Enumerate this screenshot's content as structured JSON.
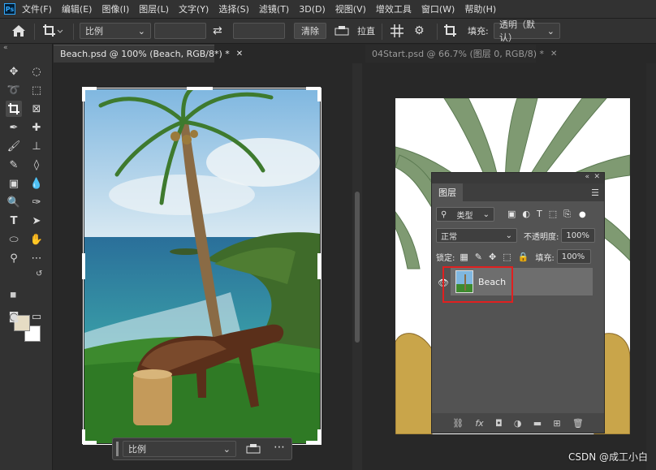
{
  "menubar": {
    "logo": "Ps",
    "items": [
      "文件(F)",
      "编辑(E)",
      "图像(I)",
      "图层(L)",
      "文字(Y)",
      "选择(S)",
      "滤镜(T)",
      "3D(D)",
      "视图(V)",
      "增效工具",
      "窗口(W)",
      "帮助(H)"
    ]
  },
  "options": {
    "ratio_label": "比例",
    "clear_label": "清除",
    "straighten_label": "拉直",
    "fill_label": "填充:",
    "fill_value": "透明（默认）"
  },
  "tabs": {
    "left": "Beach.psd @ 100% (Beach, RGB/8*) *",
    "right": "04Start.psd @ 66.7% (图层 0, RGB/8) *"
  },
  "floatbar": {
    "ratio_label": "比例"
  },
  "layers_panel": {
    "tab_label": "图层",
    "filter_kind": "类型",
    "blend_mode": "正常",
    "opacity_label": "不透明度:",
    "opacity_value": "100%",
    "lock_label": "锁定:",
    "fill_label": "填充:",
    "fill_value": "100%",
    "layer_name": "Beach"
  },
  "watermark": "CSDN @成工小白",
  "colors": {
    "foreground": "#e6dcc4",
    "background": "#ffffff",
    "highlight": "#e02020"
  }
}
